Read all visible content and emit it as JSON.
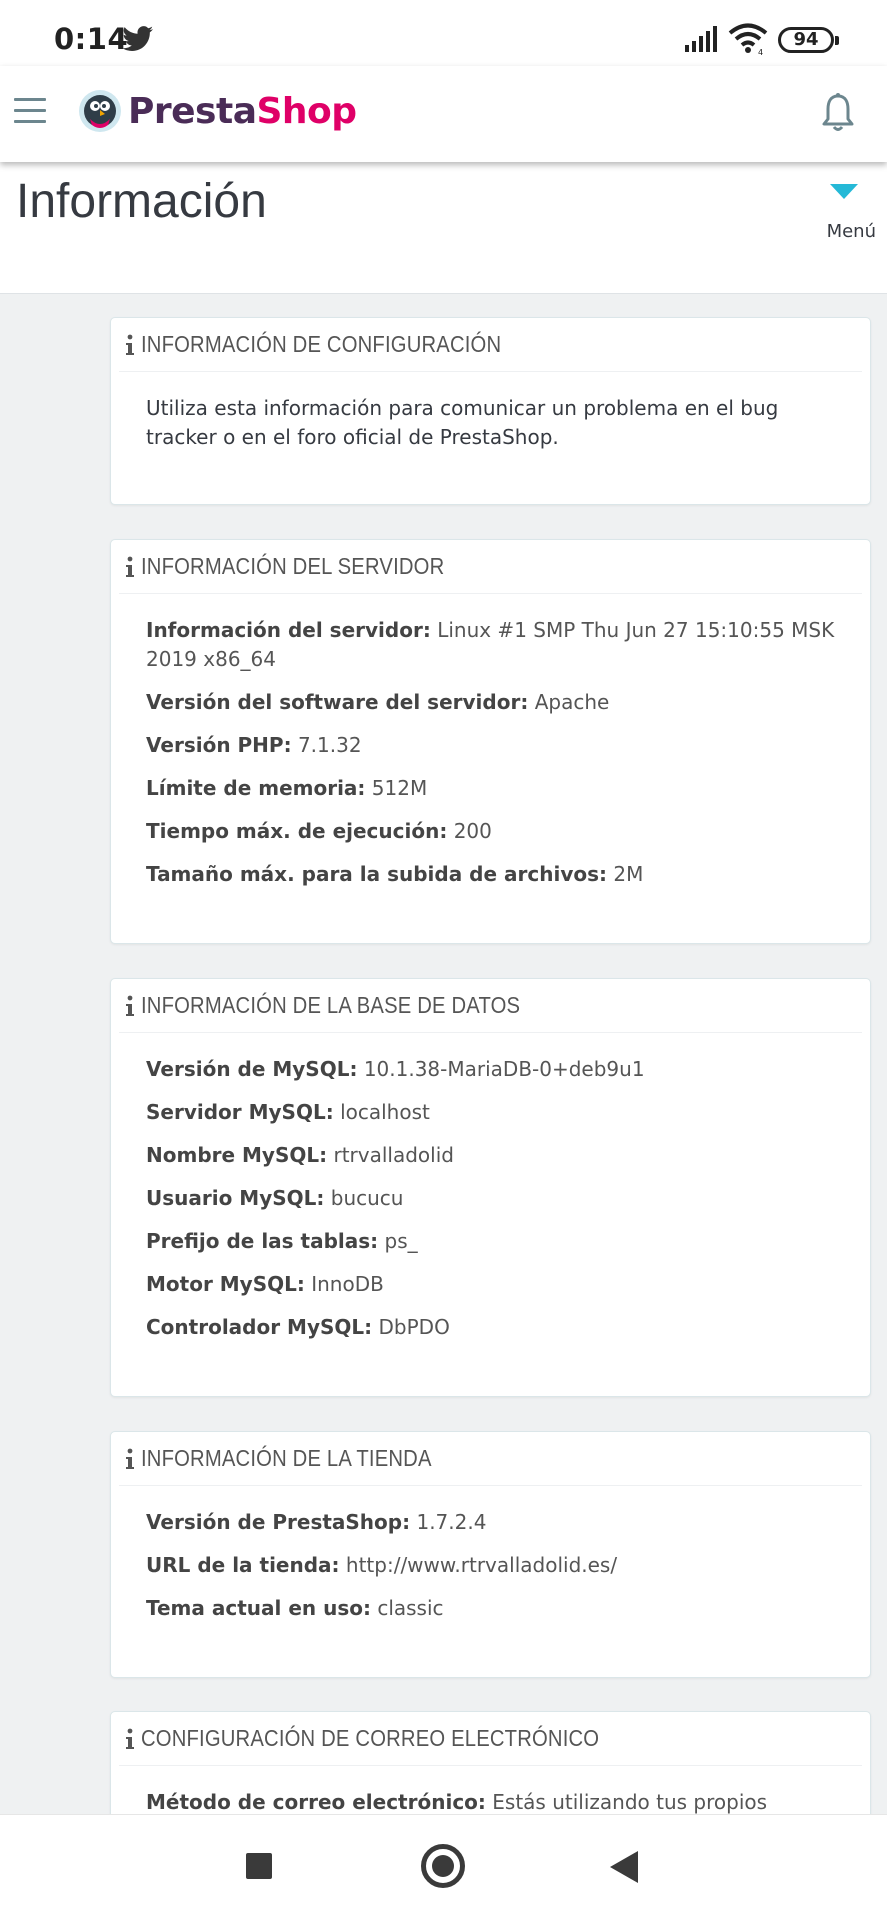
{
  "status_bar": {
    "time": "0:14",
    "battery": "94",
    "icons": [
      "twitter-icon",
      "signal-icon",
      "wifi-icon",
      "battery-icon"
    ]
  },
  "header": {
    "logo_part1": "Presta",
    "logo_part2": "Shop",
    "icons": [
      "hamburger-icon",
      "prestashop-logo-icon",
      "bell-icon"
    ],
    "colors": {
      "brand_dark": "#4a2c57",
      "brand_pink": "#df0067",
      "accent": "#25b9d7"
    }
  },
  "page": {
    "title": "Información",
    "menu_label": "Menú"
  },
  "panels": {
    "config": {
      "title": "INFORMACIÓN DE CONFIGURACIÓN",
      "text": "Utiliza esta información para comunicar un problema en el bug tracker o en el foro oficial de PrestaShop."
    },
    "server": {
      "title": "INFORMACIÓN DEL SERVIDOR",
      "rows": [
        {
          "label": "Información del servidor:",
          "value": "Linux #1 SMP Thu Jun 27 15:10:55 MSK 2019 x86_64"
        },
        {
          "label": "Versión del software del servidor:",
          "value": "Apache"
        },
        {
          "label": "Versión PHP:",
          "value": "7.1.32"
        },
        {
          "label": "Límite de memoria:",
          "value": "512M"
        },
        {
          "label": "Tiempo máx. de ejecución:",
          "value": "200"
        },
        {
          "label": "Tamaño máx. para la subida de archivos:",
          "value": "2M"
        }
      ]
    },
    "database": {
      "title": "INFORMACIÓN DE LA BASE DE DATOS",
      "rows": [
        {
          "label": "Versión de MySQL:",
          "value": "10.1.38-MariaDB-0+deb9u1"
        },
        {
          "label": "Servidor MySQL:",
          "value": "localhost"
        },
        {
          "label": "Nombre MySQL:",
          "value": "rtrvalladolid"
        },
        {
          "label": "Usuario MySQL:",
          "value": "bucucu"
        },
        {
          "label": "Prefijo de las tablas:",
          "value": "ps_"
        },
        {
          "label": "Motor MySQL:",
          "value": "InnoDB"
        },
        {
          "label": "Controlador MySQL:",
          "value": "DbPDO"
        }
      ]
    },
    "store": {
      "title": "INFORMACIÓN DE LA TIENDA",
      "rows": [
        {
          "label": "Versión de PrestaShop:",
          "value": "1.7.2.4"
        },
        {
          "label": "URL de la tienda:",
          "value": "http://www.rtrvalladolid.es/"
        },
        {
          "label": "Tema actual en uso:",
          "value": "classic"
        }
      ]
    },
    "email": {
      "title": "CONFIGURACIÓN DE CORREO ELECTRÓNICO",
      "rows": [
        {
          "label": "Método de correo electrónico:",
          "value": "Estás utilizando tus propios parámetros"
        }
      ]
    }
  },
  "nav_bar": {
    "icons": [
      "recents-square-icon",
      "home-circle-icon",
      "back-triangle-icon"
    ]
  }
}
